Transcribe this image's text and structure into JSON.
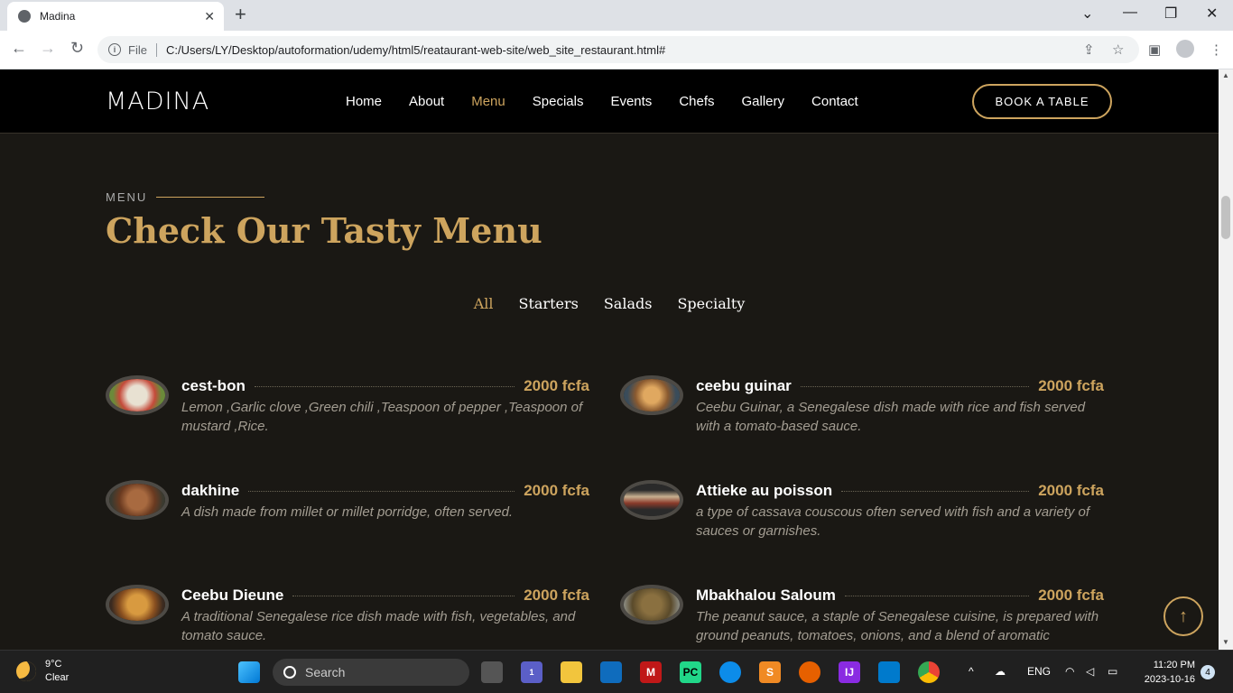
{
  "browser": {
    "tab_title": "Madina",
    "tab_close": "✕",
    "new_tab": "+",
    "file_label": "File",
    "url": "C:/Users/LY/Desktop/autoformation/udemy/html5/reataurant-web-site/web_site_restaurant.html#",
    "window_controls": {
      "minimize": "—",
      "maximize": "❐",
      "close": "✕",
      "tab_search": "⌄"
    },
    "nav": {
      "back": "←",
      "forward": "→",
      "reload": "↻"
    }
  },
  "header": {
    "logo": "MADINA",
    "nav": [
      "Home",
      "About",
      "Menu",
      "Specials",
      "Events",
      "Chefs",
      "Gallery",
      "Contact"
    ],
    "active_nav": "Menu",
    "book_button": "BOOK A TABLE"
  },
  "menu_section": {
    "label": "MENU",
    "title": "Check Our Tasty Menu",
    "filters": [
      "All",
      "Starters",
      "Salads",
      "Specialty"
    ],
    "active_filter": "All",
    "items": [
      {
        "name": "cest-bon",
        "price": "2000 fcfa",
        "description": "Lemon ,Garlic clove ,Green chili ,Teaspoon of pepper ,Teaspoon of mustard ,Rice.",
        "color": "#d9d2c4"
      },
      {
        "name": "ceebu guinar",
        "price": "2000 fcfa",
        "description": "Ceebu Guinar, a Senegalese dish made with rice and fish served with a tomato-based sauce.",
        "color": "#b88a55"
      },
      {
        "name": "dakhine",
        "price": "2000 fcfa",
        "description": "A dish made from millet or millet porridge, often served.",
        "color": "#8a5a3c"
      },
      {
        "name": "Attieke au poisson",
        "price": "2000 fcfa",
        "description": "a type of cassava couscous often served with fish and a variety of sauces or garnishes.",
        "color": "#5b4a3e"
      },
      {
        "name": "Ceebu Dieune",
        "price": "2000 fcfa",
        "description": "A traditional Senegalese rice dish made with fish, vegetables, and tomato sauce.",
        "color": "#a0703a"
      },
      {
        "name": "Mbakhalou Saloum",
        "price": "2000 fcfa",
        "description": "The peanut sauce, a staple of Senegalese cuisine, is prepared with ground peanuts, tomatoes, onions, and a blend of aromatic",
        "color": "#7a6a3a"
      }
    ]
  },
  "taskbar": {
    "weather_temp": "9°C",
    "weather_desc": "Clear",
    "search_placeholder": "Search",
    "language": "ENG",
    "time": "11:20 PM",
    "date": "2023-10-16",
    "notifications": "4",
    "teams_badge": "1"
  },
  "colors": {
    "accent": "#cda45e",
    "background": "#1a1814",
    "header": "#000000"
  }
}
